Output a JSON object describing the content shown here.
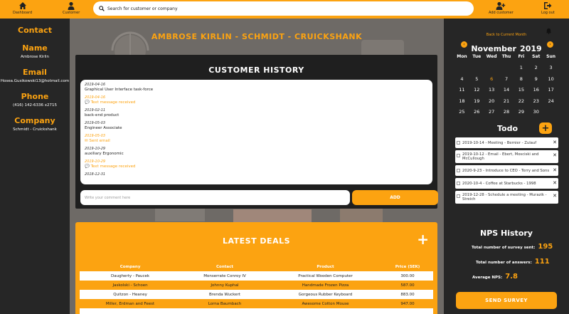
{
  "nav": {
    "dashboard": "Dashboard",
    "customer": "Customer",
    "add_customer": "Add customer",
    "logout": "Log out",
    "search_placeholder": "Search for customer or company"
  },
  "contact": {
    "heading": "Contact",
    "name_label": "Name",
    "name": "Ambrose Kirlin",
    "email_label": "Email",
    "email": "Hosea.Gusikowski13@hotmail.com",
    "phone_label": "Phone",
    "phone": "(416) 142-6336 x2715",
    "company_label": "Company",
    "company": "Schmidt - Cruickshank"
  },
  "main": {
    "title": "AMBROSE KIRLIN - SCHMIDT - CRUICKSHANK",
    "history_title": "CUSTOMER HISTORY",
    "history": [
      {
        "date": "2019-04-16",
        "text": "Graphical User Interface task-force",
        "orange": false
      },
      {
        "date": "2019-04-16",
        "text": "💬 Text message received",
        "orange": true
      },
      {
        "date": "2019-02-11",
        "text": "back-end product",
        "orange": false
      },
      {
        "date": "2019-05-03",
        "text": "Engineer Associate",
        "orange": false
      },
      {
        "date": "2019-05-03",
        "text": "✉ Sent email",
        "orange": true
      },
      {
        "date": "2019-10-29",
        "text": "auxiliary Ergonomic",
        "orange": false
      },
      {
        "date": "2019-10-29",
        "text": "💬 Text message received",
        "orange": true
      },
      {
        "date": "2018-12-31",
        "text": "",
        "orange": false
      }
    ],
    "comment_placeholder": "Write your comment here",
    "add_label": "ADD",
    "deals_title": "LATEST DEALS",
    "deals_plus": "+",
    "deals_headers": [
      "Company",
      "Contact",
      "Product",
      "Price (SEK)"
    ],
    "deals_rows": [
      [
        "Daugherty - Paucek",
        "Monserrate Conroy IV",
        "Practical Wooden Computer",
        "300.00"
      ],
      [
        "Jaskolski - Schoen",
        "Johnny Kuphal",
        "Handmade Frozen Pizza",
        "587.00"
      ],
      [
        "Quitzon - Heaney",
        "Brenda Wuckert",
        "Gorgeous Rubber Keyboard",
        "883.00"
      ],
      [
        "Miller, Erdman and Feest",
        "Lorna Baumbach",
        "Awesome Cotton Mouse",
        "947.00"
      ]
    ]
  },
  "calendar": {
    "back_label": "Back to Current Month",
    "month": "November",
    "year": "2019",
    "prev": "‹",
    "next": "›",
    "weekdays": [
      "Mon",
      "Tue",
      "Wed",
      "Thu",
      "Fri",
      "Sat",
      "Sun"
    ],
    "weeks": [
      [
        "",
        "",
        "",
        "",
        "1",
        "2",
        "3"
      ],
      [
        "4",
        "5",
        "6",
        "7",
        "8",
        "9",
        "10"
      ],
      [
        "11",
        "12",
        "13",
        "14",
        "15",
        "16",
        "17"
      ],
      [
        "18",
        "19",
        "20",
        "21",
        "22",
        "23",
        "24"
      ],
      [
        "25",
        "26",
        "27",
        "28",
        "29",
        "30",
        ""
      ]
    ],
    "today": "6"
  },
  "todo": {
    "title": "Todo",
    "add": "+",
    "items": [
      "2019-10-14 - Meeting - Bernier - Zulauf",
      "2019-10-12 - Email - Ebert, Mosciski and McCullough",
      "2020-9-23 - Introduce to CEO - Terry and Sons",
      "2020-10-4 - Coffee at Starbucks - 1998",
      "2019-12-28 - Schedule a meeting - Murazik - Streich"
    ],
    "remove": "✕"
  },
  "nps": {
    "title": "NPS History",
    "sent_label": "Total number of survey sent:",
    "sent": "195",
    "answers_label": "Total number of answers:",
    "answers": "111",
    "avg_label": "Average NPS:",
    "avg": "7.8",
    "send_label": "SEND SURVEY"
  },
  "colors": {
    "accent": "#fca311",
    "dark": "#262626"
  }
}
